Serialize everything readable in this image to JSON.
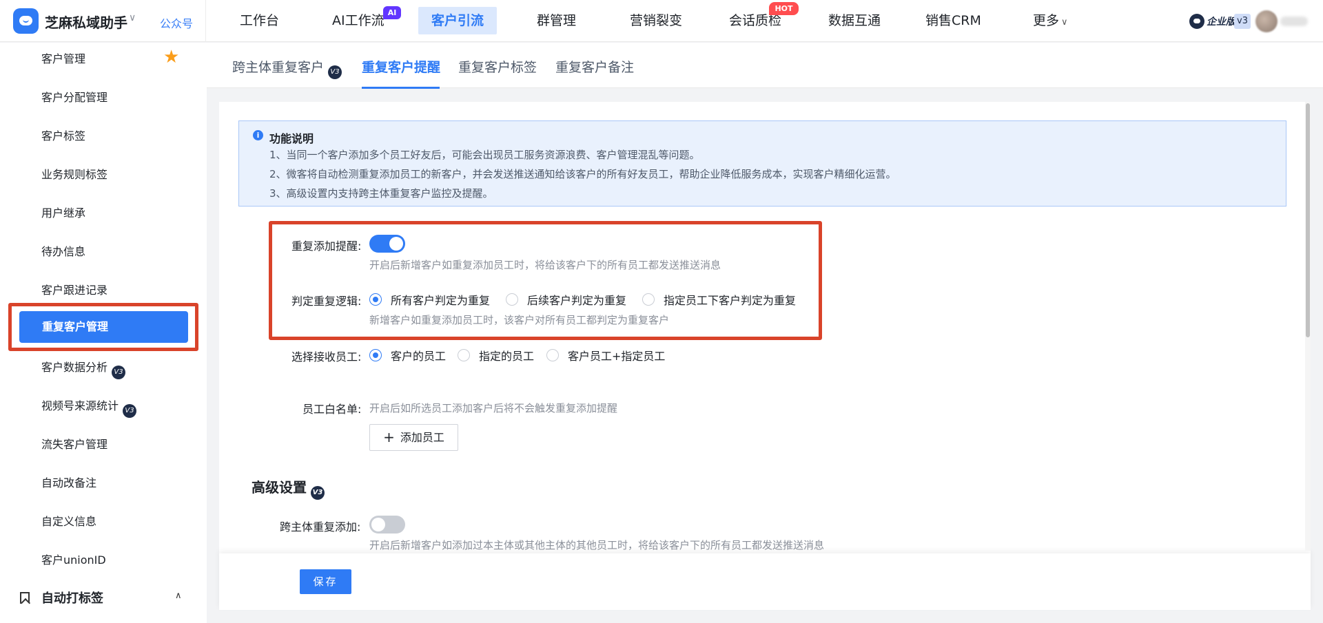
{
  "app": {
    "name": "芝麻私域助手",
    "official_account": "公众号"
  },
  "nav": {
    "items": [
      {
        "label": "工作台"
      },
      {
        "label": "AI工作流",
        "badge": "AI"
      },
      {
        "label": "客户引流",
        "active": true
      },
      {
        "label": "群管理"
      },
      {
        "label": "营销裂变"
      },
      {
        "label": "会话质检",
        "badge": "HOT"
      },
      {
        "label": "数据互通"
      },
      {
        "label": "销售CRM"
      },
      {
        "label": "更多"
      }
    ],
    "edition": "企业版",
    "version": "v3"
  },
  "sidebar": {
    "items": [
      {
        "label": "客户管理",
        "starred": true
      },
      {
        "label": "客户分配管理"
      },
      {
        "label": "客户标签"
      },
      {
        "label": "业务规则标签"
      },
      {
        "label": "用户继承"
      },
      {
        "label": "待办信息"
      },
      {
        "label": "客户跟进记录"
      },
      {
        "label": "重复客户管理",
        "active": true
      },
      {
        "label": "客户数据分析",
        "v3": true
      },
      {
        "label": "视频号来源统计",
        "v3": true
      },
      {
        "label": "流失客户管理"
      },
      {
        "label": "自动改备注"
      },
      {
        "label": "自定义信息"
      },
      {
        "label": "客户unionID"
      }
    ],
    "group": "自动打标签",
    "v3_label": "V3"
  },
  "subtabs": [
    {
      "label": "跨主体重复客户",
      "v3": true
    },
    {
      "label": "重复客户提醒",
      "active": true
    },
    {
      "label": "重复客户标签"
    },
    {
      "label": "重复客户备注"
    }
  ],
  "info": {
    "title": "功能说明",
    "lines": [
      "1、当同一个客户添加多个员工好友后，可能会出现员工服务资源浪费、客户管理混乱等问题。",
      "2、微客将自动检测重复添加员工的新客户，并会发送推送通知给该客户的所有好友员工，帮助企业降低服务成本，实现客户精细化运营。",
      "3、高级设置内支持跨主体重复客户监控及提醒。"
    ]
  },
  "form": {
    "reminder": {
      "label": "重复添加提醒:",
      "enabled": true,
      "hint": "开启后新增客户如重复添加员工时，将给该客户下的所有员工都发送推送消息"
    },
    "logic": {
      "label": "判定重复逻辑:",
      "options": [
        "所有客户判定为重复",
        "后续客户判定为重复",
        "指定员工下客户判定为重复"
      ],
      "selected": 0,
      "hint": "新增客户如重复添加员工时，该客户对所有员工都判定为重复客户"
    },
    "receiver": {
      "label": "选择接收员工:",
      "options": [
        "客户的员工",
        "指定的员工",
        "客户员工+指定员工"
      ],
      "selected": 0
    },
    "whitelist": {
      "label": "员工白名单:",
      "hint": "开启后如所选员工添加客户后将不会触发重复添加提醒",
      "add_button": "添加员工"
    }
  },
  "advanced": {
    "title": "高级设置",
    "cross_entity": {
      "label": "跨主体重复添加:",
      "enabled": false,
      "hint": "开启后新增客户如添加过本主体或其他主体的其他员工时，将给该客户下的所有员工都发送推送消息"
    }
  },
  "footer": {
    "save": "保存"
  },
  "colors": {
    "primary": "#2f7bf5",
    "highlight": "#d9432a",
    "ai_badge": "#6236ff",
    "hot_badge": "#ff4d4f"
  }
}
